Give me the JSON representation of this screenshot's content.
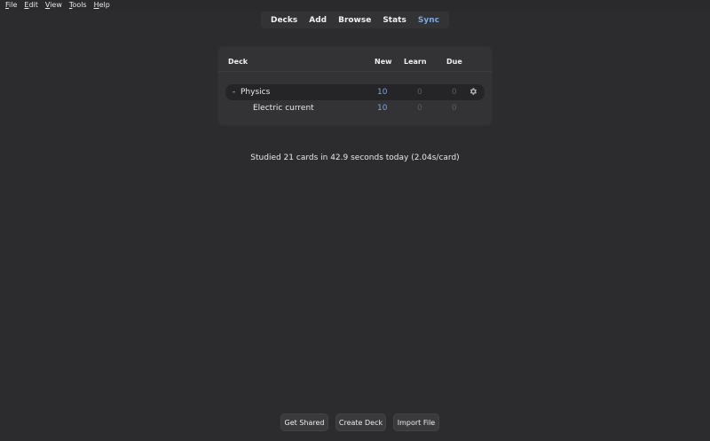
{
  "menubar": {
    "items": [
      {
        "first": "F",
        "rest": "ile"
      },
      {
        "first": "E",
        "rest": "dit"
      },
      {
        "first": "V",
        "rest": "iew"
      },
      {
        "first": "T",
        "rest": "ools"
      },
      {
        "first": "H",
        "rest": "elp"
      }
    ]
  },
  "toolbar": {
    "items": [
      "Decks",
      "Add",
      "Browse",
      "Stats",
      "Sync"
    ]
  },
  "deck_table": {
    "headers": {
      "deck": "Deck",
      "new": "New",
      "learn": "Learn",
      "due": "Due"
    },
    "rows": [
      {
        "collapse": "-",
        "name": "Physics",
        "new": "10",
        "learn": "0",
        "due": "0",
        "icon": "gear-icon"
      },
      {
        "collapse": "",
        "name": "Electric current",
        "new": "10",
        "learn": "0",
        "due": "0"
      }
    ]
  },
  "studied_text": "Studied 21 cards in 42.9 seconds today (2.04s/card)",
  "bottom_buttons": {
    "get_shared": "Get Shared",
    "create_deck": "Create Deck",
    "import_file": "Import File"
  },
  "colors": {
    "background": "#2c2c2e",
    "panel": "#333336",
    "accent_blue": "#7aa4e0",
    "sync_blue": "#7fa6d9",
    "muted": "#5a5a5e"
  }
}
